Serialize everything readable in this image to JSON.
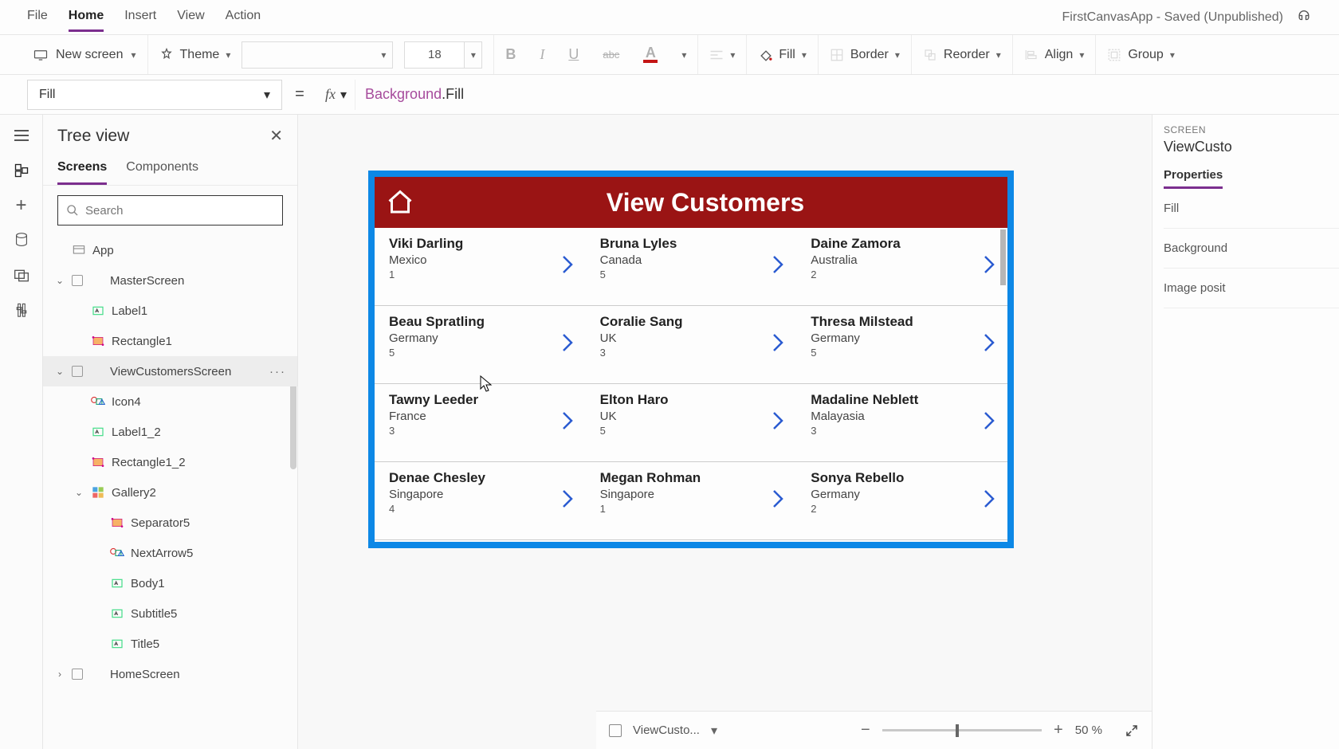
{
  "menu": {
    "items": [
      "File",
      "Home",
      "Insert",
      "View",
      "Action"
    ],
    "active_index": 1,
    "app_title": "FirstCanvasApp - Saved (Unpublished)"
  },
  "toolbar": {
    "new_screen": "New screen",
    "theme": "Theme",
    "font_size": "18",
    "fill_label": "Fill",
    "border_label": "Border",
    "reorder_label": "Reorder",
    "align_label": "Align",
    "group_label": "Group"
  },
  "formula": {
    "property": "Fill",
    "token1": "Background",
    "token2": ".Fill"
  },
  "tree": {
    "title": "Tree view",
    "tabs": [
      "Screens",
      "Components"
    ],
    "active_tab": 0,
    "search_placeholder": "Search",
    "items": [
      {
        "label": "App",
        "indent": 0,
        "icon": "app",
        "expand": ""
      },
      {
        "label": "MasterScreen",
        "indent": 0,
        "icon": "screen",
        "expand": "v",
        "chk": true
      },
      {
        "label": "Label1",
        "indent": 1,
        "icon": "label"
      },
      {
        "label": "Rectangle1",
        "indent": 1,
        "icon": "rect"
      },
      {
        "label": "ViewCustomersScreen",
        "indent": 0,
        "icon": "screen",
        "expand": "v",
        "chk": true,
        "sel": true,
        "dots": true
      },
      {
        "label": "Icon4",
        "indent": 1,
        "icon": "iconctrl"
      },
      {
        "label": "Label1_2",
        "indent": 1,
        "icon": "label"
      },
      {
        "label": "Rectangle1_2",
        "indent": 1,
        "icon": "rect"
      },
      {
        "label": "Gallery2",
        "indent": 1,
        "icon": "gallery",
        "expand": "v"
      },
      {
        "label": "Separator5",
        "indent": 2,
        "icon": "rect"
      },
      {
        "label": "NextArrow5",
        "indent": 2,
        "icon": "iconctrl"
      },
      {
        "label": "Body1",
        "indent": 2,
        "icon": "label"
      },
      {
        "label": "Subtitle5",
        "indent": 2,
        "icon": "label"
      },
      {
        "label": "Title5",
        "indent": 2,
        "icon": "label"
      },
      {
        "label": "HomeScreen",
        "indent": 0,
        "icon": "screen",
        "expand": ">",
        "chk": true
      }
    ]
  },
  "canvas": {
    "header_title": "View Customers",
    "customers": [
      {
        "name": "Viki  Darling",
        "country": "Mexico",
        "num": "1"
      },
      {
        "name": "Bruna  Lyles",
        "country": "Canada",
        "num": "5"
      },
      {
        "name": "Daine  Zamora",
        "country": "Australia",
        "num": "2"
      },
      {
        "name": "Beau  Spratling",
        "country": "Germany",
        "num": "5"
      },
      {
        "name": "Coralie  Sang",
        "country": "UK",
        "num": "3"
      },
      {
        "name": "Thresa  Milstead",
        "country": "Germany",
        "num": "5"
      },
      {
        "name": "Tawny  Leeder",
        "country": "France",
        "num": "3"
      },
      {
        "name": "Elton  Haro",
        "country": "UK",
        "num": "5"
      },
      {
        "name": "Madaline  Neblett",
        "country": "Malayasia",
        "num": "3"
      },
      {
        "name": "Denae  Chesley",
        "country": "Singapore",
        "num": "4"
      },
      {
        "name": "Megan  Rohman",
        "country": "Singapore",
        "num": "1"
      },
      {
        "name": "Sonya  Rebello",
        "country": "Germany",
        "num": "2"
      }
    ]
  },
  "status": {
    "crumb": "ViewCusto...",
    "zoom_value": "50",
    "zoom_unit": "%"
  },
  "props": {
    "kicker": "SCREEN",
    "name": "ViewCusto",
    "tab": "Properties",
    "rows": [
      "Fill",
      "Background",
      "Image posit"
    ]
  }
}
